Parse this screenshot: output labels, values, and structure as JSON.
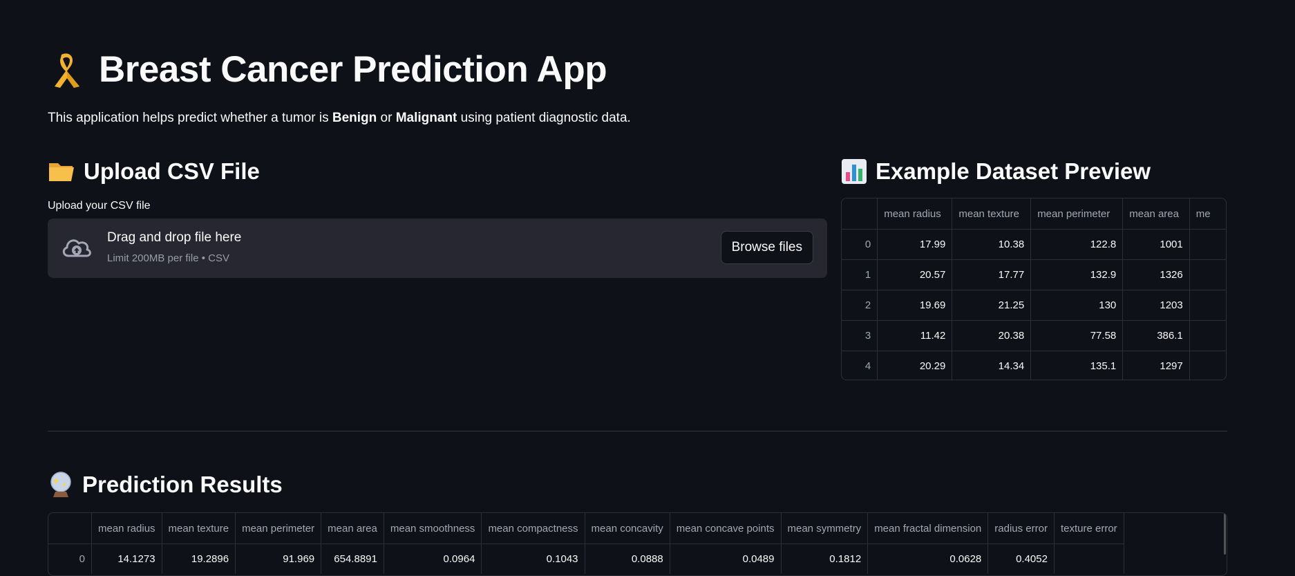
{
  "header": {
    "icon": "ribbon-emoji",
    "title": "Breast Cancer Prediction App",
    "intro_prefix": "This application helps predict whether a tumor is ",
    "intro_benign": "Benign",
    "intro_or": " or ",
    "intro_malignant": "Malignant",
    "intro_suffix": " using patient diagnostic data."
  },
  "upload": {
    "icon": "folder-emoji",
    "heading": "Upload CSV File",
    "label": "Upload your CSV file",
    "drop_title": "Drag and drop file here",
    "drop_sub": "Limit 200MB per file • CSV",
    "browse_label": "Browse files"
  },
  "preview": {
    "icon": "bar-chart-emoji",
    "heading": "Example Dataset Preview",
    "columns": [
      "",
      "mean radius",
      "mean texture",
      "mean perimeter",
      "mean area",
      "me"
    ],
    "rows": [
      [
        "0",
        "17.99",
        "10.38",
        "122.8",
        "1001",
        ""
      ],
      [
        "1",
        "20.57",
        "17.77",
        "132.9",
        "1326",
        ""
      ],
      [
        "2",
        "19.69",
        "21.25",
        "130",
        "1203",
        ""
      ],
      [
        "3",
        "11.42",
        "20.38",
        "77.58",
        "386.1",
        ""
      ],
      [
        "4",
        "20.29",
        "14.34",
        "135.1",
        "1297",
        ""
      ]
    ]
  },
  "results": {
    "icon": "crystal-ball-emoji",
    "heading": "Prediction Results",
    "columns": [
      "",
      "mean radius",
      "mean texture",
      "mean perimeter",
      "mean area",
      "mean smoothness",
      "mean compactness",
      "mean concavity",
      "mean concave points",
      "mean symmetry",
      "mean fractal dimension",
      "radius error",
      "texture error"
    ],
    "rows": [
      [
        "0",
        "14.1273",
        "19.2896",
        "91.969",
        "654.8891",
        "0.0964",
        "0.1043",
        "0.0888",
        "0.0489",
        "0.1812",
        "0.0628",
        "0.4052",
        ""
      ]
    ]
  }
}
